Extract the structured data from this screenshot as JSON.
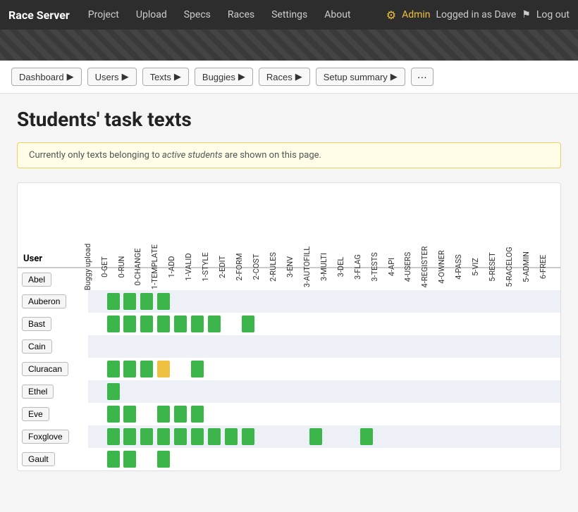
{
  "navbar": {
    "brand": "Race Server",
    "links": [
      "Project",
      "Upload",
      "Specs",
      "Races",
      "Settings",
      "About"
    ],
    "admin_label": "Admin",
    "logged_in_label": "Logged in as Dave",
    "logout_label": "Log out"
  },
  "breadcrumbs": [
    {
      "label": "Dashboard",
      "arrow": true
    },
    {
      "label": "Users",
      "arrow": true
    },
    {
      "label": "Texts",
      "arrow": true
    },
    {
      "label": "Buggies",
      "arrow": true
    },
    {
      "label": "Races",
      "arrow": true
    },
    {
      "label": "Setup summary",
      "arrow": true
    }
  ],
  "breadcrumb_more": "···",
  "page_title": "Students' task texts",
  "info_text_pre": "Currently only texts belonging to ",
  "info_text_em": "active students",
  "info_text_post": " are shown on this page.",
  "table": {
    "user_col_header": "User",
    "columns": [
      "Buggy upload",
      "0-GET",
      "0-RUN",
      "0-CHANGE",
      "1-TEMPLATE",
      "1-ADD",
      "1-VALID",
      "1-STYLE",
      "2-EDIT",
      "2-FORM",
      "2-COST",
      "2-RULES",
      "3-ENV",
      "3-AUTOFILL",
      "3-MULTI",
      "3-DEL",
      "3-FLAG",
      "3-TESTS",
      "4-API",
      "4-USERS",
      "4-REGISTER",
      "4-OWNER",
      "4-PASS",
      "5-VIZ",
      "5-RESET",
      "5-RACELOG",
      "5-ADMIN",
      "6-FREE"
    ],
    "rows": [
      {
        "user": "Abel",
        "cells": [
          0,
          0,
          0,
          0,
          0,
          0,
          0,
          0,
          0,
          0,
          0,
          0,
          0,
          0,
          0,
          0,
          0,
          0,
          0,
          0,
          0,
          0,
          0,
          0,
          0,
          0,
          0,
          0
        ]
      },
      {
        "user": "Auberon",
        "cells": [
          0,
          1,
          1,
          1,
          1,
          0,
          0,
          0,
          0,
          0,
          0,
          0,
          0,
          0,
          0,
          0,
          0,
          0,
          0,
          0,
          0,
          0,
          0,
          0,
          0,
          0,
          0,
          0
        ]
      },
      {
        "user": "Bast",
        "cells": [
          0,
          1,
          1,
          1,
          1,
          1,
          1,
          1,
          0,
          1,
          0,
          0,
          0,
          0,
          0,
          0,
          0,
          0,
          0,
          0,
          0,
          0,
          0,
          0,
          0,
          0,
          0,
          0
        ]
      },
      {
        "user": "Cain",
        "cells": [
          0,
          0,
          0,
          0,
          0,
          0,
          0,
          0,
          0,
          0,
          0,
          0,
          0,
          0,
          0,
          0,
          0,
          0,
          0,
          0,
          0,
          0,
          0,
          0,
          0,
          0,
          0,
          0
        ]
      },
      {
        "user": "Cluracan",
        "cells": [
          0,
          1,
          1,
          1,
          2,
          0,
          1,
          0,
          0,
          0,
          0,
          0,
          0,
          0,
          0,
          0,
          0,
          0,
          0,
          0,
          0,
          0,
          0,
          0,
          0,
          0,
          0,
          0
        ]
      },
      {
        "user": "Ethel",
        "cells": [
          0,
          1,
          0,
          0,
          0,
          0,
          0,
          0,
          0,
          0,
          0,
          0,
          0,
          0,
          0,
          0,
          0,
          0,
          0,
          0,
          0,
          0,
          0,
          0,
          0,
          0,
          0,
          0
        ]
      },
      {
        "user": "Eve",
        "cells": [
          0,
          1,
          1,
          0,
          1,
          1,
          1,
          0,
          0,
          0,
          0,
          0,
          0,
          0,
          0,
          0,
          0,
          0,
          0,
          0,
          0,
          0,
          0,
          0,
          0,
          0,
          0,
          0
        ]
      },
      {
        "user": "Foxglove",
        "cells": [
          0,
          1,
          1,
          1,
          1,
          1,
          1,
          1,
          1,
          1,
          0,
          0,
          0,
          1,
          0,
          0,
          1,
          0,
          0,
          0,
          0,
          0,
          0,
          0,
          0,
          0,
          0,
          0
        ]
      },
      {
        "user": "Gault",
        "cells": [
          0,
          1,
          1,
          0,
          1,
          0,
          0,
          0,
          0,
          0,
          0,
          0,
          0,
          0,
          0,
          0,
          0,
          0,
          0,
          0,
          0,
          0,
          0,
          0,
          0,
          0,
          0,
          0
        ]
      }
    ]
  }
}
